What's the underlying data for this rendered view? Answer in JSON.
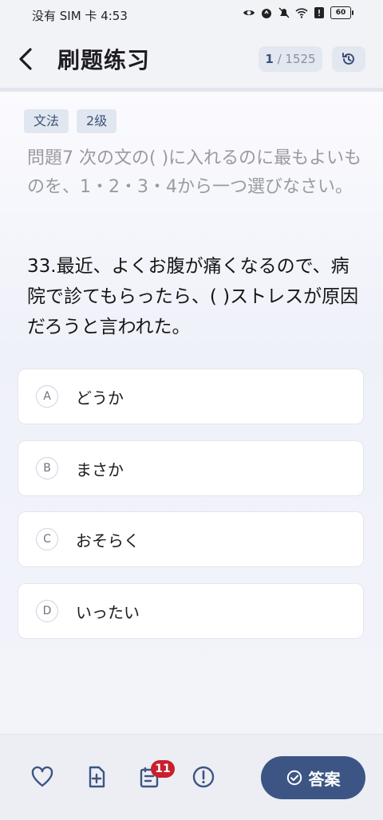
{
  "status_bar": {
    "carrier_time": "没有 SIM 卡 4:53",
    "battery": "60"
  },
  "header": {
    "title": "刷题练习",
    "current": "1",
    "total": "/ 1525"
  },
  "tags": [
    "文法",
    "2级"
  ],
  "instruction": "問題7 次の文の( )に入れるのに最もよいものを、1・2・3・4から一つ選びなさい。",
  "question": "33.最近、よくお腹が痛くなるので、病院で診てもらったら、( )ストレスが原因だろうと言われた。",
  "options": [
    {
      "letter": "A",
      "text": "どうか"
    },
    {
      "letter": "B",
      "text": "まさか"
    },
    {
      "letter": "C",
      "text": "おそらく"
    },
    {
      "letter": "D",
      "text": "いったい"
    }
  ],
  "bottom_bar": {
    "notes_badge": "11",
    "answer_label": "答案"
  },
  "colors": {
    "accent": "#3d5585",
    "badge": "#c8202c",
    "tag_bg": "#e1e7f0"
  }
}
